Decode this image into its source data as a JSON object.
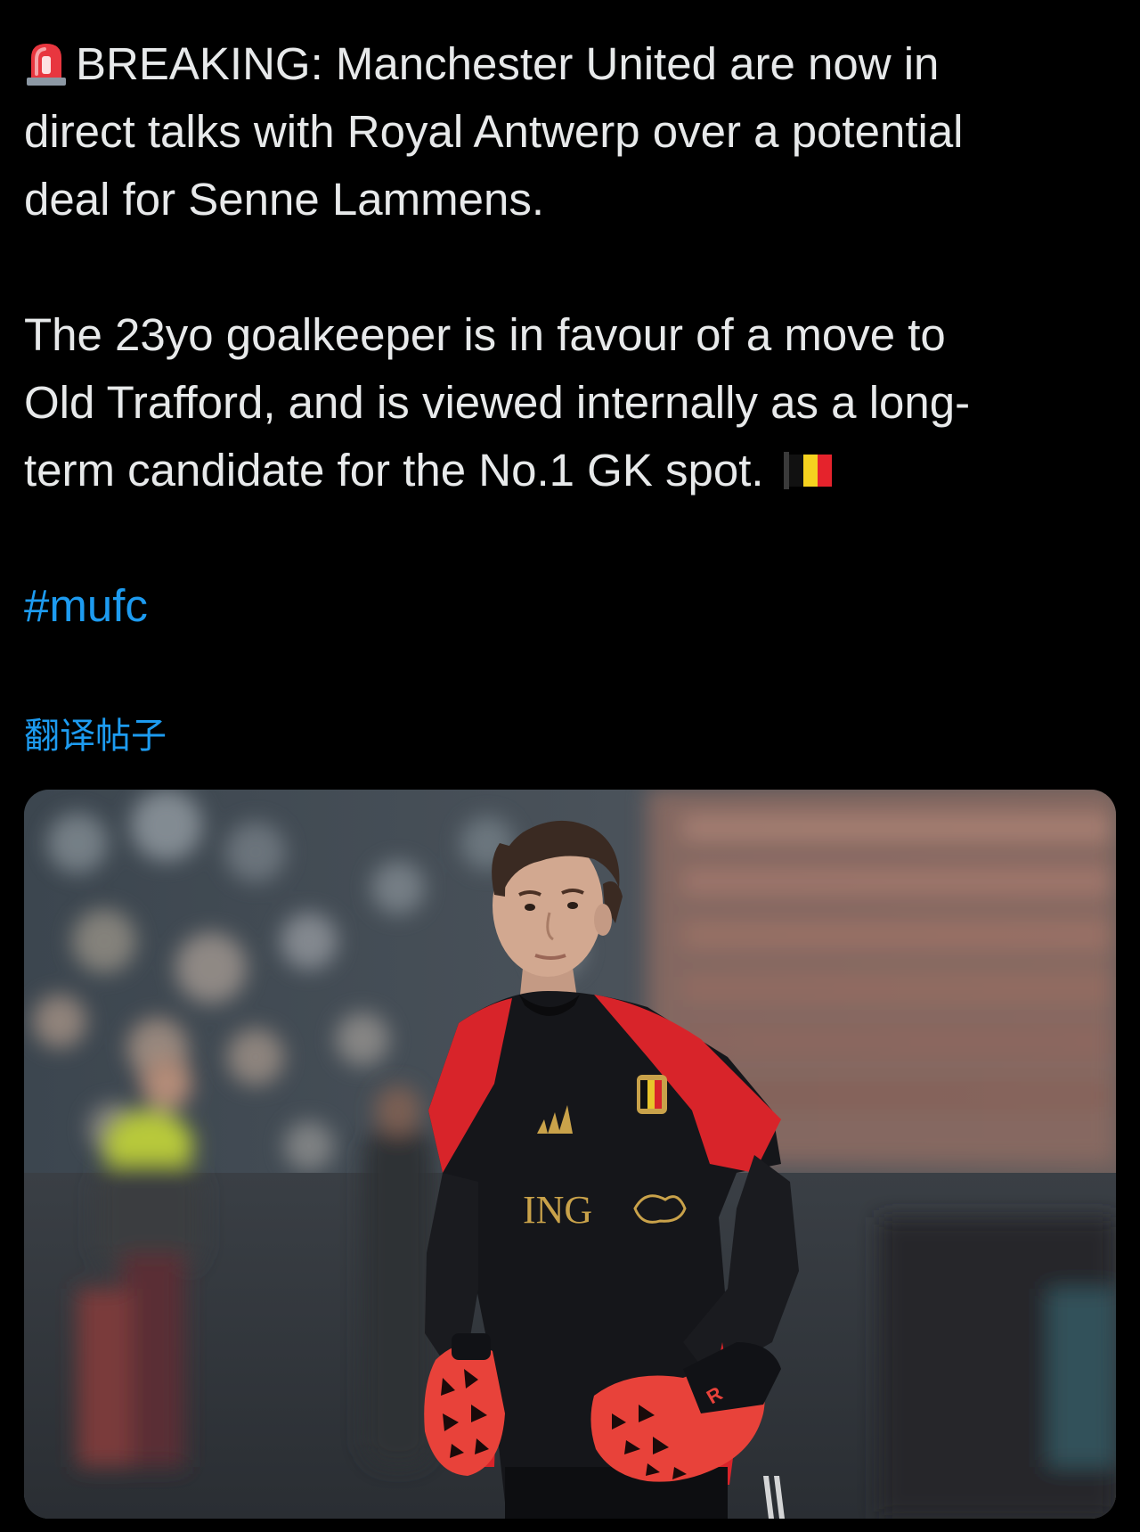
{
  "tweet": {
    "text_lines_1": [
      "BREAKING: Manchester United are now in",
      "direct talks with Royal Antwerp over a potential",
      "deal for Senne Lammens."
    ],
    "text_lines_2": [
      "The 23yo goalkeeper is in favour of a move to",
      "Old Trafford, and is viewed internally as a long-",
      "term candidate for the No.1 GK spot."
    ],
    "hashtag": "#mufc",
    "translate_label": "翻译帖子",
    "leading_emoji": "rotating-light-emoji",
    "trailing_emoji": "belgium-flag-emoji"
  },
  "media": {
    "type": "photo",
    "subject": "goalkeeper-in-belgium-training-kit",
    "shirt_sponsor": "ING"
  },
  "colors": {
    "background": "#000000",
    "text": "#e7e9ea",
    "link": "#1d9bf0",
    "kit_black": "#15161a",
    "kit_red": "#d8242a",
    "glove_red": "#e8423a"
  }
}
